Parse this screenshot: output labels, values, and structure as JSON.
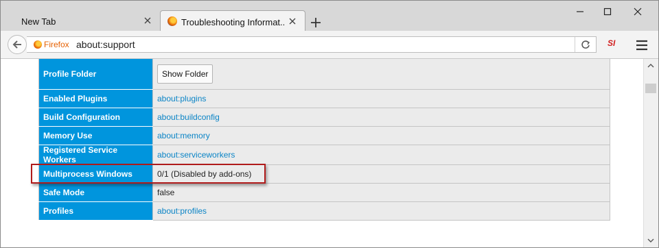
{
  "window": {
    "tabs": [
      {
        "label": "New Tab",
        "active": false
      },
      {
        "label": "Troubleshooting Informat...",
        "active": true
      }
    ],
    "new_tab_icon": "plus-icon",
    "controls": [
      "minimize-icon",
      "maximize-icon",
      "close-icon"
    ]
  },
  "toolbar": {
    "back_icon": "back-arrow-icon",
    "identity_label": "Firefox",
    "url": "about:support",
    "reload_icon": "reload-icon",
    "extension_label": "SI",
    "menu_icon": "hamburger-menu-icon"
  },
  "table": {
    "rows": [
      {
        "key": "Profile Folder",
        "value": "Show Folder",
        "type": "button"
      },
      {
        "key": "Enabled Plugins",
        "value": "about:plugins",
        "type": "link"
      },
      {
        "key": "Build Configuration",
        "value": "about:buildconfig",
        "type": "link"
      },
      {
        "key": "Memory Use",
        "value": "about:memory",
        "type": "link"
      },
      {
        "key": "Registered Service Workers",
        "value": "about:serviceworkers",
        "type": "link"
      },
      {
        "key": "Multiprocess Windows",
        "value": "0/1 (Disabled by add-ons)",
        "type": "text",
        "highlighted": true
      },
      {
        "key": "Safe Mode",
        "value": "false",
        "type": "text"
      },
      {
        "key": "Profiles",
        "value": "about:profiles",
        "type": "link"
      }
    ]
  },
  "colors": {
    "key_cell": "#0095dd",
    "value_cell": "#ebebeb",
    "link": "#0a84c6",
    "highlight_border": "#b01a1a"
  }
}
